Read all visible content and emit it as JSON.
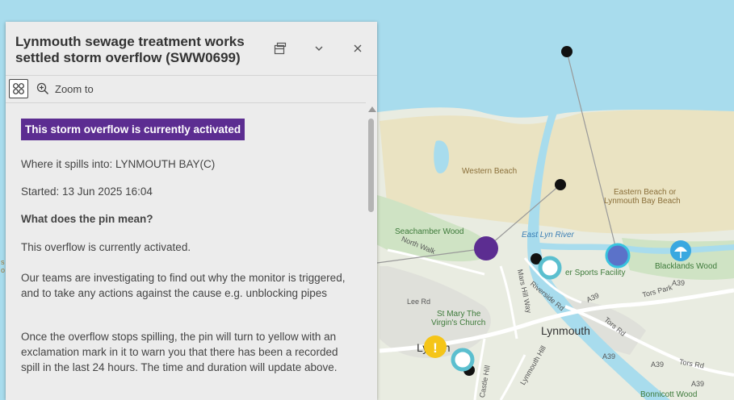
{
  "panel": {
    "title": "Lynmouth sewage treatment works settled storm overflow (SWW0699)",
    "icons": {
      "dock": "dock-icon",
      "collapse": "chevron-down-icon",
      "close": "close-icon"
    },
    "toolbar": {
      "grid_icon": "grid-icon",
      "zoom_icon": "zoom-in-icon",
      "zoom_label": "Zoom to"
    },
    "status_badge": "This storm overflow is currently activated",
    "status_color": "#5c2d91",
    "spills_into": "Where it spills into: LYNMOUTH BAY(C)",
    "started": "Started: 13 Jun 2025 16:04",
    "pin_heading": "What does the pin mean?",
    "pin_meaning": "This overflow is currently activated.",
    "investigation": "Our teams are investigating to find out why the monitor is triggered, and to take any actions against the cause e.g. unblocking pipes",
    "after_spill": "Once the overflow stops spilling, the pin will turn to yellow with an exclamation mark in it to warn you that there has been a recorded spill in the last 24 hours. The time and duration will update above."
  },
  "map": {
    "labels": {
      "western_beach": "Western Beach",
      "eastern_beach_1": "Eastern Beach or",
      "eastern_beach_2": "Lynmouth Bay Beach",
      "seachamber_wood": "Seachamber Wood",
      "north_walk": "North Walk",
      "east_lyn_river": "East Lyn River",
      "sports_facility": "er Sports Facility",
      "blacklands_wood": "Blacklands Wood",
      "a39_1": "A39",
      "a39_2": "A39",
      "a39_3": "A39",
      "a39_4": "A39",
      "a39_5": "A39",
      "tors_park": "Tors Park",
      "tors_rd_1": "Tors Rd",
      "tors_rd_2": "Tors Rd",
      "mars_hill_way": "Mars Hill Way",
      "riverside_rd": "Riverside Rd",
      "lee_rd": "Lee Rd",
      "church_1": "St Mary The",
      "church_2": "Virgin's Church",
      "lynmouth": "Lynmouth",
      "lynton": "Lynton",
      "lynmouth_hill": "Lynmouth Hill",
      "castle_hill": "Castle Hill",
      "bonnicott_wood": "Bonnicott Wood",
      "edge_s": "s",
      "edge_o": "o"
    },
    "colors": {
      "sea": "#a8dced",
      "beach": "#eae3c2",
      "land": "#e9ece1",
      "woodland": "#cfe3c4",
      "activated_pin": "#5c2d91",
      "recent_spill_pin": "#f5c518",
      "monitor_pin": "#5b72c9",
      "ring_pin": "#5bbfcf"
    }
  }
}
